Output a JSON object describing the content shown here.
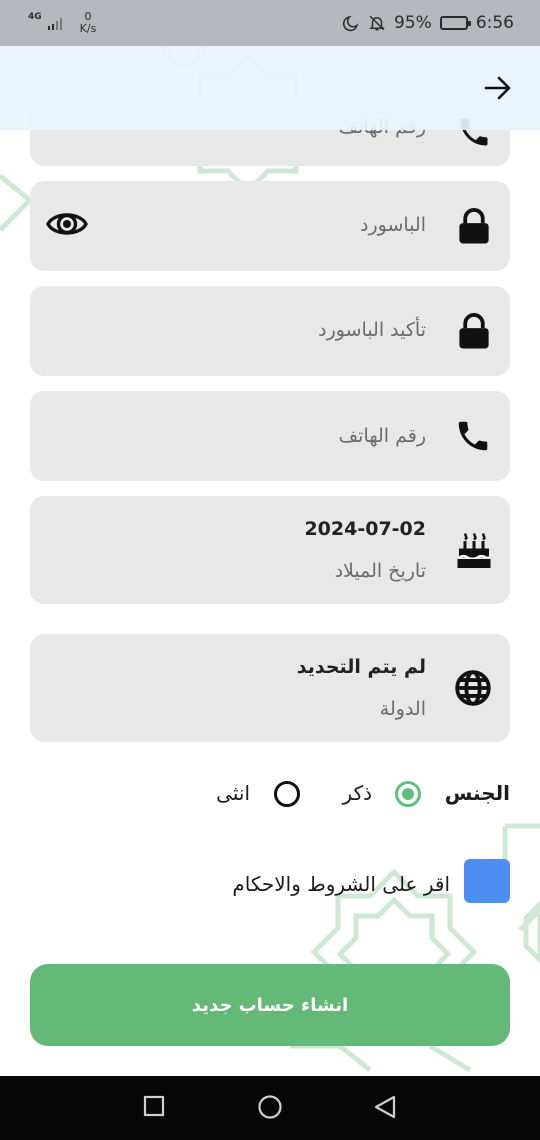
{
  "status_bar": {
    "network_type": "4G",
    "speed_value": "0",
    "speed_unit": "K/s",
    "battery_percent": "95%",
    "battery_level": 0.95,
    "time": "6:56",
    "icons": [
      "moon-icon",
      "bell-off-icon",
      "battery-icon",
      "signal-icon"
    ]
  },
  "app_bar": {
    "back_icon": "arrow-right-icon"
  },
  "form": {
    "partial_field_label": "رقم الهاتف",
    "password": {
      "label": "الباسورد",
      "icon": "lock-icon",
      "toggle_icon": "eye-icon"
    },
    "confirm_password": {
      "label": "تأكيد الباسورد",
      "icon": "lock-icon"
    },
    "phone": {
      "label": "رقم الهاتف",
      "icon": "phone-icon"
    },
    "birthdate": {
      "value": "2024-07-02",
      "label": "تاريخ الميلاد",
      "icon": "cake-icon"
    },
    "country": {
      "value": "لم يتم التحديد",
      "label": "الدولة",
      "icon": "globe-icon"
    },
    "gender": {
      "label": "الجنس",
      "options": [
        {
          "label": "ذكر",
          "selected": true
        },
        {
          "label": "انثى",
          "selected": false
        }
      ]
    },
    "terms": {
      "label": "اقر على الشروط والاحكام",
      "checked": true
    },
    "submit_label": "انشاء حساب جديد"
  },
  "colors": {
    "accent_green": "#65b978",
    "radio_green": "#5fbf80",
    "checkbox_blue": "#4d8ef4",
    "field_bg": "#e8e8e8",
    "app_bar_bg": "#e8f3fd",
    "pattern": "#cfe8d6"
  },
  "nav_bar": {
    "buttons": [
      "recent-apps-square-icon",
      "home-circle-icon",
      "back-triangle-icon"
    ]
  }
}
